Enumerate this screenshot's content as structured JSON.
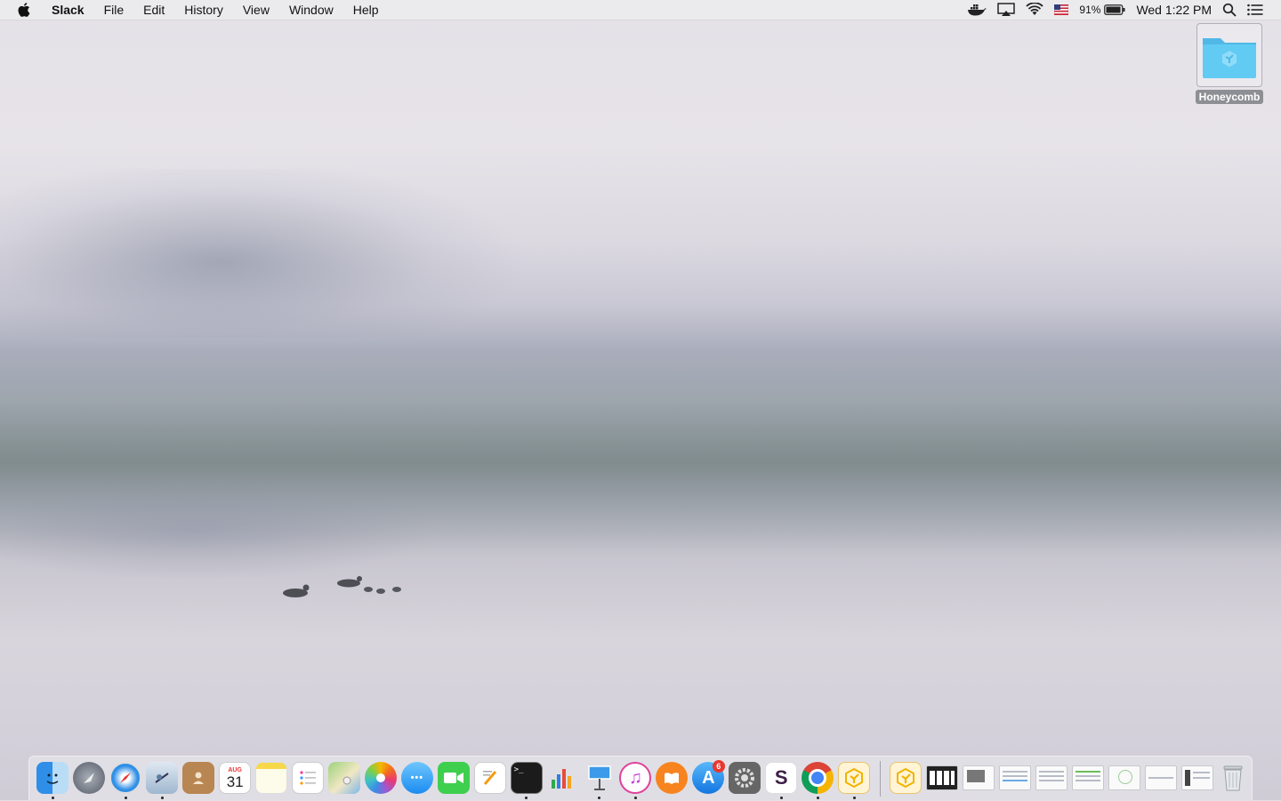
{
  "menubar": {
    "app_name": "Slack",
    "menus": [
      "File",
      "Edit",
      "History",
      "View",
      "Window",
      "Help"
    ],
    "battery_percent": "91%",
    "clock": "Wed 1:22 PM",
    "status_icons": [
      "docker-icon",
      "airplay-icon",
      "wifi-icon",
      "us-flag-icon",
      "battery-icon",
      "spotlight-icon",
      "notification-center-icon"
    ]
  },
  "desktop": {
    "folder_label": "Honeycomb"
  },
  "dock": {
    "apps": [
      {
        "name": "finder",
        "running": true
      },
      {
        "name": "launchpad",
        "running": false
      },
      {
        "name": "safari",
        "running": true
      },
      {
        "name": "mail",
        "running": true
      },
      {
        "name": "contacts",
        "running": false
      },
      {
        "name": "calendar",
        "running": false,
        "month": "AUG",
        "day": "31"
      },
      {
        "name": "notes",
        "running": false
      },
      {
        "name": "reminders",
        "running": false
      },
      {
        "name": "maps",
        "running": false
      },
      {
        "name": "photos",
        "running": false
      },
      {
        "name": "messages",
        "running": false
      },
      {
        "name": "facetime",
        "running": false
      },
      {
        "name": "pages",
        "running": false
      },
      {
        "name": "terminal",
        "running": true
      },
      {
        "name": "numbers",
        "running": false
      },
      {
        "name": "keynote",
        "running": true
      },
      {
        "name": "itunes",
        "running": true
      },
      {
        "name": "ibooks",
        "running": false
      },
      {
        "name": "app-store",
        "running": false,
        "badge": "6"
      },
      {
        "name": "system-preferences",
        "running": false
      },
      {
        "name": "slack",
        "running": true
      },
      {
        "name": "chrome",
        "running": true
      },
      {
        "name": "honeycomb",
        "running": true
      }
    ],
    "documents": [
      "honeycomb-folder",
      "screenshot-1",
      "screenshot-2",
      "screenshot-3",
      "screenshot-4",
      "screenshot-5",
      "screenshot-6",
      "screenshot-7",
      "screenshot-8"
    ],
    "trash_icon": "trash-icon"
  },
  "colors": {
    "menubar_bg": "#ececee",
    "folder_blue": "#5ec8f2",
    "badge_red": "#e8372f"
  }
}
